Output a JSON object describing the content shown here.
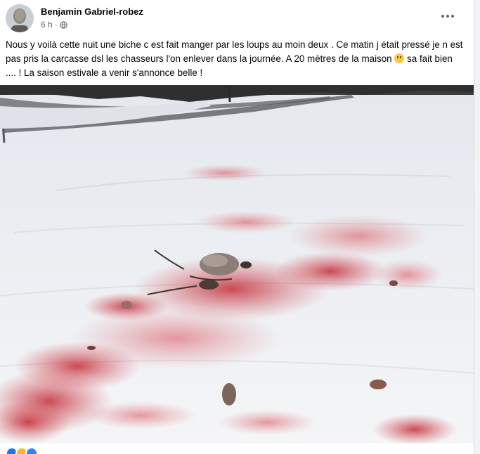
{
  "post": {
    "author": "Benjamin Gabriel-robez",
    "timestamp": "6 h",
    "separator": "·",
    "privacy_icon": "globe-icon",
    "more_icon": "more-options-icon",
    "text_part1": "Nous y voilà cette nuit une biche c est fait manger par les loups au moin deux . Ce matin j était pressé je n est pas pris la carcasse dsl les chasseurs l'on enlever dans la journée. A 20 mètres de la maison ",
    "emoji": "worried-face-emoji",
    "text_part2": " sa fait bien .... ! La saison estivale a venir s'annonce belle !",
    "photo": "snowy field with blood stains and deer carcass remains",
    "reaction_icons": [
      "like-icon",
      "wow-icon",
      "care-icon"
    ]
  },
  "colors": {
    "background": "#f0f2f5",
    "card": "#ffffff",
    "primary_text": "#050505",
    "secondary_text": "#65676b",
    "blood": "#c9303a",
    "snow": "#eef1f5"
  }
}
